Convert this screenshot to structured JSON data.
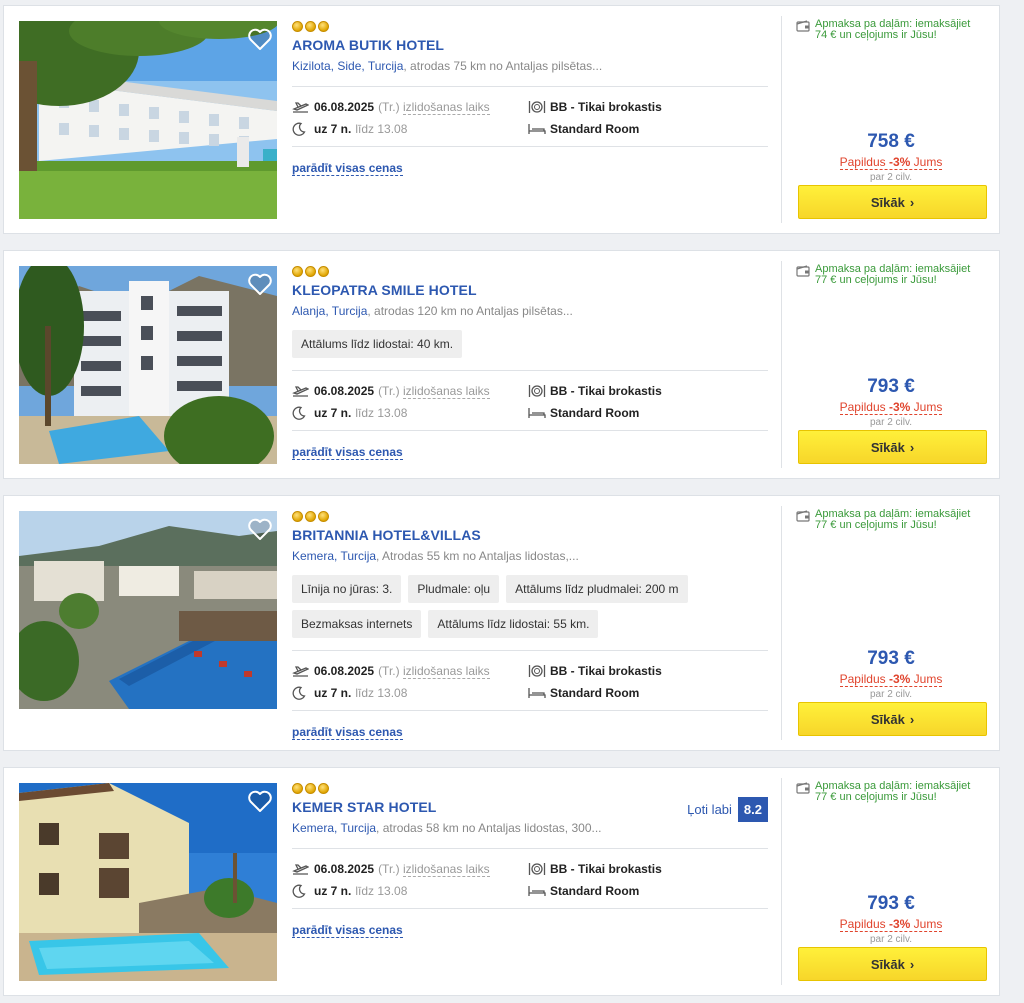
{
  "hotels": [
    {
      "name": "AROMA BUTIK HOTEL",
      "location_link": "Kizilota, Side, Turcija",
      "location_rest": ", atrodas 75 km no Antaljas pilsētas...",
      "date": "06.08.2025",
      "weekday": "(Tr.)",
      "departure_label": "izlidošanas laiks",
      "nights": "uz 7 n.",
      "until": "līdz 13.08",
      "board": "BB - Tikai brokastis",
      "room": "Standard Room",
      "show_prices": "parādīt visas cenas",
      "installment_line1": "Apmaksa pa daļām: iemaksājiet",
      "installment_line2": "74 € un ceļojums ir Jūsu!",
      "price": "758 €",
      "discount_pre": "Papildus ",
      "discount_pct": "-3%",
      "discount_post": " Jums",
      "per_persons": "par 2 cilv.",
      "button": "Sīkāk"
    },
    {
      "name": "KLEOPATRA SMILE HOTEL",
      "location_link": "Alanja, Turcija",
      "location_rest": ", atrodas 120 km no Antaljas pilsētas...",
      "tags": [
        "Attālums līdz lidostai: 40 km."
      ],
      "date": "06.08.2025",
      "weekday": "(Tr.)",
      "departure_label": "izlidošanas laiks",
      "nights": "uz 7 n.",
      "until": "līdz 13.08",
      "board": "BB - Tikai brokastis",
      "room": "Standard Room",
      "show_prices": "parādīt visas cenas",
      "installment_line1": "Apmaksa pa daļām: iemaksājiet",
      "installment_line2": "77 € un ceļojums ir Jūsu!",
      "price": "793 €",
      "discount_pre": "Papildus ",
      "discount_pct": "-3%",
      "discount_post": " Jums",
      "per_persons": "par 2 cilv.",
      "button": "Sīkāk"
    },
    {
      "name": "BRITANNIA HOTEL&VILLAS",
      "location_link": "Kemera, Turcija",
      "location_rest": ", Atrodas 55 km no Antaljas lidostas,...",
      "tags": [
        "Līnija no jūras: 3.",
        "Pludmale: oļu",
        "Attālums līdz pludmalei: 200 m",
        "Bezmaksas internets",
        "Attālums līdz lidostai: 55 km."
      ],
      "date": "06.08.2025",
      "weekday": "(Tr.)",
      "departure_label": "izlidošanas laiks",
      "nights": "uz 7 n.",
      "until": "līdz 13.08",
      "board": "BB - Tikai brokastis",
      "room": "Standard Room",
      "show_prices": "parādīt visas cenas",
      "installment_line1": "Apmaksa pa daļām: iemaksājiet",
      "installment_line2": "77 € un ceļojums ir Jūsu!",
      "price": "793 €",
      "discount_pre": "Papildus ",
      "discount_pct": "-3%",
      "discount_post": " Jums",
      "per_persons": "par 2 cilv.",
      "button": "Sīkāk"
    },
    {
      "name": "KEMER STAR HOTEL",
      "location_link": "Kemera, Turcija",
      "location_rest": ", atrodas 58 km no Antaljas lidostas, 300...",
      "rating_label": "Ļoti labi",
      "rating_score": "8.2",
      "date": "06.08.2025",
      "weekday": "(Tr.)",
      "departure_label": "izlidošanas laiks",
      "nights": "uz 7 n.",
      "until": "līdz 13.08",
      "board": "BB - Tikai brokastis",
      "room": "Standard Room",
      "show_prices": "parādīt visas cenas",
      "installment_line1": "Apmaksa pa daļām: iemaksājiet",
      "installment_line2": "77 € un ceļojums ir Jūsu!",
      "price": "793 €",
      "discount_pre": "Papildus ",
      "discount_pct": "-3%",
      "discount_post": " Jums",
      "per_persons": "par 2 cilv.",
      "button": "Sīkāk"
    }
  ],
  "icons": {
    "favorite": "heart-icon",
    "departure": "airplane-icon",
    "nights": "moon-icon",
    "board": "plate-cutlery-icon",
    "room": "bed-icon",
    "installment": "wallet-icon",
    "button_arrow": "chevron-right-icon"
  },
  "colors": {
    "accent": "#2d58b0",
    "discount": "#e0442d",
    "installment": "#3a9a3a",
    "button": "#f7d62a"
  }
}
